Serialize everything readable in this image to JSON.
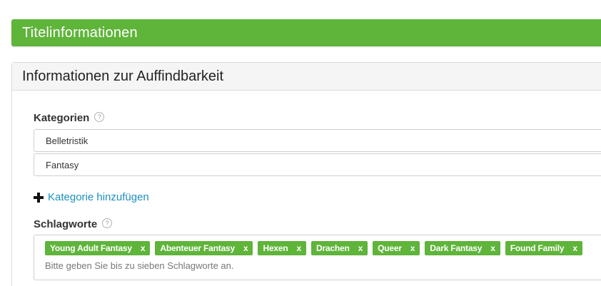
{
  "header": {
    "title": "Titelinformationen"
  },
  "section": {
    "title": "Informationen zur Auffindbarkeit"
  },
  "categories": {
    "label": "Kategorien",
    "help": "?",
    "values": [
      "Belletristik",
      "Fantasy"
    ],
    "add_label": "Kategorie hinzufügen"
  },
  "keywords": {
    "label": "Schlagworte",
    "help": "?",
    "remove_glyph": "x",
    "tags": [
      "Young Adult Fantasy",
      "Abenteuer Fantasy",
      "Hexen",
      "Drachen",
      "Queer",
      "Dark Fantasy",
      "Found Family"
    ],
    "hint": "Bitte geben Sie bis zu sieben Schlagworte an."
  },
  "colors": {
    "accent_green": "#5fb43a",
    "link_blue": "#1d8fbf"
  }
}
